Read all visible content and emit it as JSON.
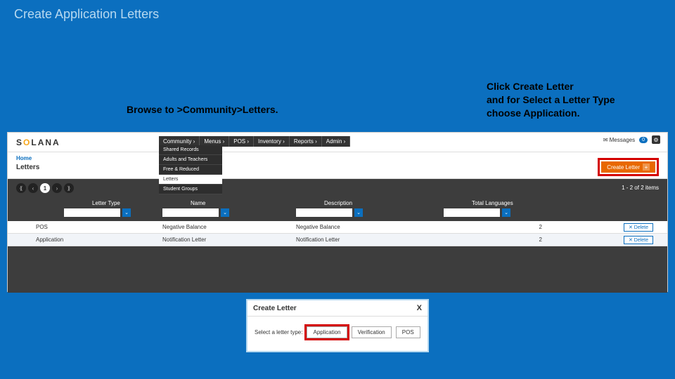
{
  "slide": {
    "title": "Create Application Letters",
    "caption_left": "Browse to >Community>Letters.",
    "caption_right": "Click Create Letter\nand for Select a Letter Type\nchoose Application."
  },
  "app": {
    "logo_prefix": "S",
    "logo_mid": "O",
    "logo_suffix": "LANA",
    "nav": [
      "Community ›",
      "Menus ›",
      "POS ›",
      "Inventory ›",
      "Reports ›",
      "Admin ›"
    ],
    "dropdown": {
      "items": [
        "Shared Records",
        "Adults and Teachers",
        "Free & Reduced",
        "Letters",
        "Student Groups"
      ],
      "active_index": 3
    },
    "messages_label": "Messages",
    "messages_count": "0",
    "breadcrumb_home": "Home",
    "breadcrumb_page": "Letters",
    "create_button": "Create Letter",
    "create_plus": "+",
    "page_info": "1 - 2 of 2 items",
    "columns": [
      "Letter Type",
      "Name",
      "Description",
      "Total Languages"
    ],
    "pager": [
      "⟪",
      "‹",
      "1",
      "›",
      "⟫"
    ],
    "pager_active_index": 2,
    "rows": [
      {
        "type": "POS",
        "name": "Negative Balance",
        "desc": "Negative Balance",
        "langs": "2",
        "delete": "Delete"
      },
      {
        "type": "Application",
        "name": "Notification Letter",
        "desc": "Notification Letter",
        "langs": "2",
        "delete": "Delete"
      }
    ]
  },
  "modal": {
    "title": "Create Letter",
    "close": "X",
    "prompt": "Select a letter type:",
    "options": [
      "Application",
      "Verification",
      "POS"
    ],
    "highlight_index": 0
  }
}
